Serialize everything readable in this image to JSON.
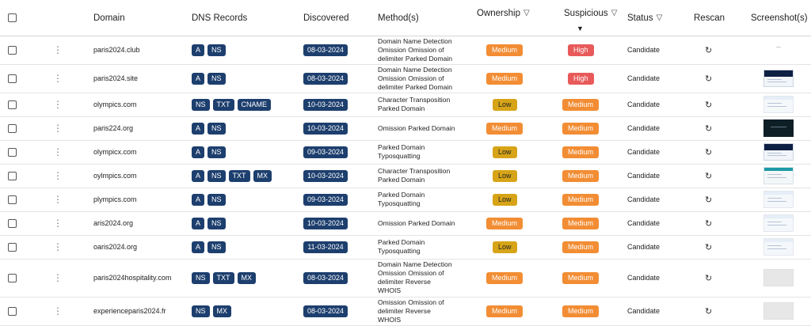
{
  "header": {
    "domain": "Domain",
    "dns": "DNS Records",
    "discovered": "Discovered",
    "methods": "Method(s)",
    "ownership": "Ownership",
    "suspicious": "Suspicious",
    "status": "Status",
    "rescan": "Rescan",
    "screenshots": "Screenshot(s)"
  },
  "icons": {
    "filter": "▽",
    "sort_desc": "▼",
    "kebab": "⋮",
    "rescan": "↻"
  },
  "colors": {
    "chip": "#1d3f6e",
    "medium": "#f28d34",
    "high": "#e85a5a",
    "low": "#d7a417"
  },
  "rows": [
    {
      "domain": "paris2024.club",
      "dns": [
        "A",
        "NS"
      ],
      "discovered": "08-03-2024",
      "methods": [
        "Domain Name Detection",
        "Omission Omission of",
        "delimiter Parked Domain"
      ],
      "ownership": "Medium",
      "suspicious": "High",
      "status": "Candidate",
      "thumb": "blank"
    },
    {
      "domain": "paris2024.site",
      "dns": [
        "A",
        "NS"
      ],
      "discovered": "08-03-2024",
      "methods": [
        "Domain Name Detection",
        "Omission Omission of",
        "delimiter Parked Domain"
      ],
      "ownership": "Medium",
      "suspicious": "High",
      "status": "Candidate",
      "thumb": "dark"
    },
    {
      "domain": "olympics.com",
      "dns": [
        "NS",
        "TXT",
        "CNAME"
      ],
      "discovered": "10-03-2024",
      "methods": [
        "Character Transposition",
        "Parked Domain"
      ],
      "ownership": "Low",
      "suspicious": "Medium",
      "status": "Candidate",
      "thumb": "light"
    },
    {
      "domain": "paris224.org",
      "dns": [
        "A",
        "NS"
      ],
      "discovered": "10-03-2024",
      "methods": [
        "Omission Parked Domain"
      ],
      "ownership": "Medium",
      "suspicious": "Medium",
      "status": "Candidate",
      "thumb": "black"
    },
    {
      "domain": "olympicx.com",
      "dns": [
        "A",
        "NS"
      ],
      "discovered": "09-03-2024",
      "methods": [
        "Parked Domain",
        "Typosquatting"
      ],
      "ownership": "Low",
      "suspicious": "Medium",
      "status": "Candidate",
      "thumb": "dark"
    },
    {
      "domain": "oylmpics.com",
      "dns": [
        "A",
        "NS",
        "TXT",
        "MX"
      ],
      "discovered": "10-03-2024",
      "methods": [
        "Character Transposition",
        "Parked Domain"
      ],
      "ownership": "Low",
      "suspicious": "Medium",
      "status": "Candidate",
      "thumb": "teal"
    },
    {
      "domain": "plympics.com",
      "dns": [
        "A",
        "NS"
      ],
      "discovered": "09-03-2024",
      "methods": [
        "Parked Domain",
        "Typosquatting"
      ],
      "ownership": "Low",
      "suspicious": "Medium",
      "status": "Candidate",
      "thumb": "light"
    },
    {
      "domain": "aris2024.org",
      "dns": [
        "A",
        "NS"
      ],
      "discovered": "10-03-2024",
      "methods": [
        "Omission Parked Domain"
      ],
      "ownership": "Medium",
      "suspicious": "Medium",
      "status": "Candidate",
      "thumb": "light"
    },
    {
      "domain": "oaris2024.org",
      "dns": [
        "A",
        "NS"
      ],
      "discovered": "11-03-2024",
      "methods": [
        "Parked Domain",
        "Typosquatting"
      ],
      "ownership": "Low",
      "suspicious": "Medium",
      "status": "Candidate",
      "thumb": "light"
    },
    {
      "domain": "paris2024hospitality.com",
      "dns": [
        "NS",
        "TXT",
        "MX"
      ],
      "discovered": "08-03-2024",
      "methods": [
        "Domain Name Detection",
        "Omission Omission of",
        "delimiter Reverse",
        "WHOIS"
      ],
      "ownership": "Medium",
      "suspicious": "Medium",
      "status": "Candidate",
      "thumb": "gray"
    },
    {
      "domain": "experienceparis2024.fr",
      "dns": [
        "NS",
        "MX"
      ],
      "discovered": "08-03-2024",
      "methods": [
        "Omission Omission of",
        "delimiter Reverse",
        "WHOIS"
      ],
      "ownership": "Medium",
      "suspicious": "Medium",
      "status": "Candidate",
      "thumb": "gray"
    }
  ]
}
